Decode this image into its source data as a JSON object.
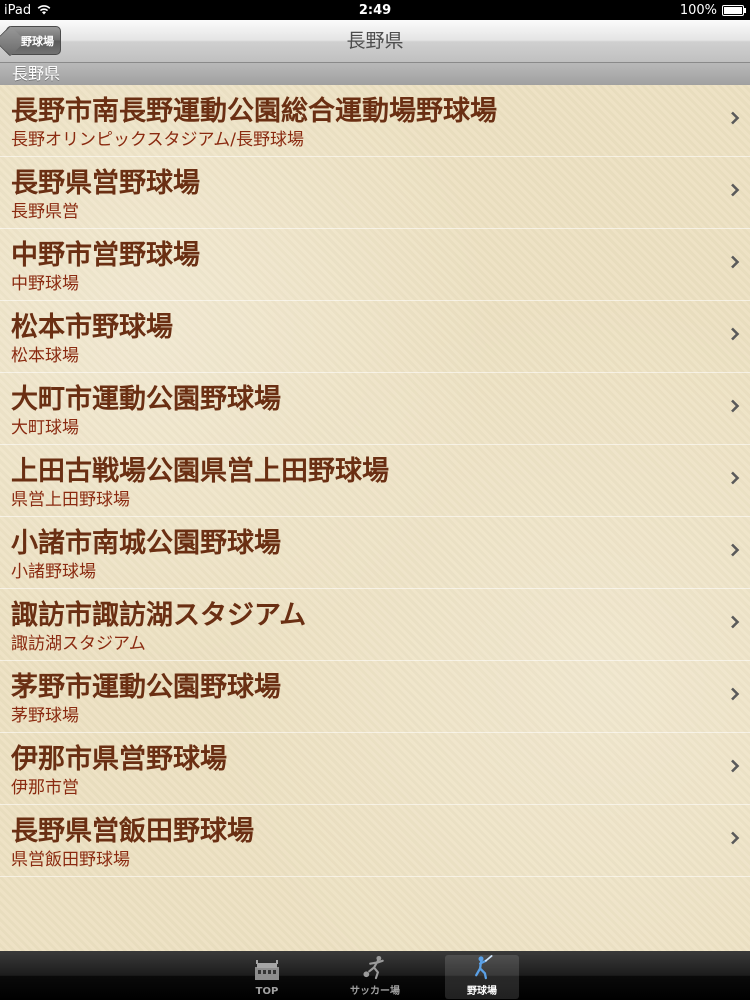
{
  "status_bar": {
    "carrier": "iPad",
    "time": "2:49",
    "battery": "100%"
  },
  "nav": {
    "back_label": "野球場",
    "title": "長野県"
  },
  "section": {
    "header": "長野県"
  },
  "rows": [
    {
      "title": "長野市南長野運動公園総合運動場野球場",
      "subtitle": "長野オリンピックスタジアム/長野球場"
    },
    {
      "title": "長野県営野球場",
      "subtitle": "長野県営"
    },
    {
      "title": "中野市営野球場",
      "subtitle": "中野球場"
    },
    {
      "title": "松本市野球場",
      "subtitle": "松本球場"
    },
    {
      "title": "大町市運動公園野球場",
      "subtitle": "大町球場"
    },
    {
      "title": "上田古戦場公園県営上田野球場",
      "subtitle": "県営上田野球場"
    },
    {
      "title": "小諸市南城公園野球場",
      "subtitle": "小諸野球場"
    },
    {
      "title": "諏訪市諏訪湖スタジアム",
      "subtitle": "諏訪湖スタジアム"
    },
    {
      "title": "茅野市運動公園野球場",
      "subtitle": "茅野球場"
    },
    {
      "title": "伊那市県営野球場",
      "subtitle": "伊那市営"
    },
    {
      "title": "長野県営飯田野球場",
      "subtitle": "県営飯田野球場"
    }
  ],
  "tabs": [
    {
      "label": "TOP",
      "icon": "stadium-icon"
    },
    {
      "label": "サッカー場",
      "icon": "soccer-player-icon"
    },
    {
      "label": "野球場",
      "icon": "baseball-player-icon"
    }
  ],
  "colors": {
    "row_title": "#6a2f13",
    "row_subtitle": "#8a2a10",
    "background": "#ede1c2",
    "active_tab_icon": "#5aa0e6"
  }
}
